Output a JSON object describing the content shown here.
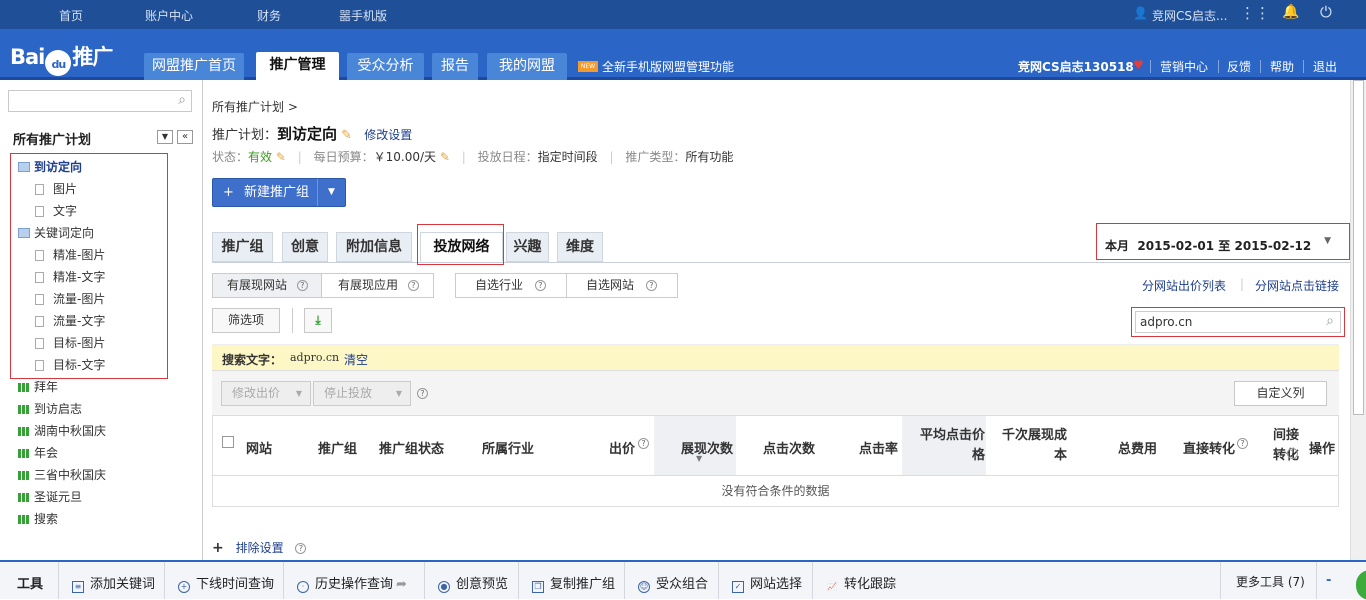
{
  "topnav": {
    "home": "首页",
    "account": "账户中心",
    "finance": "财务",
    "mobile": "噐手机版",
    "user": "竞网CS启志..."
  },
  "header": {
    "logo_left": "Bai",
    "logo_mid": "du",
    "logo_right": "推广",
    "tabs": [
      "网盟推广首页",
      "推广管理",
      "受众分析",
      "报告",
      "我的网盟"
    ],
    "new_badge": "NEW",
    "new_text": "全新手机版网盟管理功能",
    "account": "竞网CS启志130518",
    "heart": "♥",
    "links": [
      "营销中心",
      "反馈",
      "帮助",
      "退出"
    ]
  },
  "sidebar": {
    "title": "所有推广计划",
    "items": [
      {
        "label": "到访定向",
        "kind": "folder",
        "bold": true
      },
      {
        "label": "图片",
        "kind": "doc"
      },
      {
        "label": "文字",
        "kind": "doc"
      },
      {
        "label": "关键词定向",
        "kind": "folder"
      },
      {
        "label": "精准-图片",
        "kind": "doc"
      },
      {
        "label": "精准-文字",
        "kind": "doc"
      },
      {
        "label": "流量-图片",
        "kind": "doc"
      },
      {
        "label": "流量-文字",
        "kind": "doc"
      },
      {
        "label": "目标-图片",
        "kind": "doc"
      },
      {
        "label": "目标-文字",
        "kind": "doc"
      },
      {
        "label": "拜年",
        "kind": "bar"
      },
      {
        "label": "到访启志",
        "kind": "bar"
      },
      {
        "label": "湖南中秋国庆",
        "kind": "bar"
      },
      {
        "label": "年会",
        "kind": "bar"
      },
      {
        "label": "三省中秋国庆",
        "kind": "bar"
      },
      {
        "label": "圣诞元旦",
        "kind": "bar"
      },
      {
        "label": "搜索",
        "kind": "bar"
      }
    ]
  },
  "main": {
    "breadcrumb": "所有推广计划 >",
    "plan_label": "推广计划：",
    "plan_name": "到访定向",
    "modify": "修改设置",
    "status_label": "状态：",
    "status_value": "有效",
    "budget_label": "每日预算：",
    "budget_value": "￥10.00/天",
    "schedule_label": "投放日程：",
    "schedule_value": "指定时间段",
    "type_label": "推广类型：",
    "type_value": "所有功能",
    "new_group": "新建推广组",
    "tabs": [
      "推广组",
      "创意",
      "附加信息",
      "投放网络",
      "兴趣",
      "维度"
    ],
    "date_prefix": "本月",
    "date_range": "2015-02-01 至 2015-02-12",
    "subtabs": [
      "有展现网站",
      "有展现应用",
      "自选行业",
      "自选网站"
    ],
    "link_bid": "分网站出价列表",
    "link_click": "分网站点击链接",
    "filter": "筛选项",
    "search_value": "adpro.cn",
    "search_text_label": "搜索文字：",
    "search_text_value": "adpro.cn",
    "clear": "清空",
    "modify_bid": "修改出价",
    "stop": "停止投放",
    "custom_cols": "自定义列",
    "columns": [
      "网站",
      "推广组",
      "推广组状态",
      "所属行业",
      "出价",
      "展现次数",
      "点击次数",
      "点击率",
      "平均点击价格",
      "千次展现成本",
      "总费用",
      "直接转化",
      "间接转化",
      "操作"
    ],
    "empty": "没有符合条件的数据",
    "exclude": "排除设置"
  },
  "toolbar": {
    "tool": "工具",
    "items": [
      "添加关键词",
      "下线时间查询",
      "历史操作查询",
      "创意预览",
      "复制推广组",
      "受众组合",
      "网站选择",
      "转化跟踪"
    ],
    "more": "更多工具 (7)",
    "collapse": "-"
  }
}
